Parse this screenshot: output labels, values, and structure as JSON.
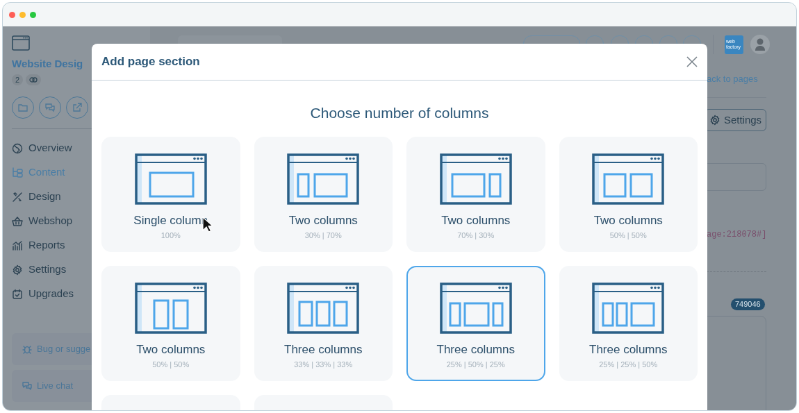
{
  "background_app": {
    "project_title": "Website Desig",
    "badge_count": "2",
    "nav": [
      {
        "label": "Overview",
        "selected": false
      },
      {
        "label": "Content",
        "selected": true
      },
      {
        "label": "Design",
        "selected": false
      },
      {
        "label": "Webshop",
        "selected": false
      },
      {
        "label": "Reports",
        "selected": false
      },
      {
        "label": "Settings",
        "selected": false
      },
      {
        "label": "Upgrades",
        "selected": false
      }
    ],
    "feedback_button": "Bug or sugge",
    "chat_button": "Live chat",
    "brand_logo": "web factory",
    "back_link": "ack to pages",
    "settings_button": "Settings",
    "shortcode": "age:218078#]",
    "id_badge": "749046"
  },
  "dialog": {
    "title": "Add page section",
    "heading": "Choose number of columns",
    "options": [
      {
        "kind": "single",
        "title": "Single column",
        "ratio": "100%",
        "selected": false
      },
      {
        "kind": "narrow-wide",
        "title": "Two columns",
        "ratio": "30% | 70%",
        "selected": false
      },
      {
        "kind": "wide-narrow",
        "title": "Two columns",
        "ratio": "70% | 30%",
        "selected": false
      },
      {
        "kind": "halves",
        "title": "Two columns",
        "ratio": "50% | 50%",
        "selected": false
      },
      {
        "kind": "tall-halves",
        "title": "Two columns",
        "ratio": "50% | 50%",
        "selected": false
      },
      {
        "kind": "thirds",
        "title": "Three columns",
        "ratio": "33% | 33% | 33%",
        "selected": false
      },
      {
        "kind": "center-wide",
        "title": "Three columns",
        "ratio": "25% | 50% | 25%",
        "selected": true
      },
      {
        "kind": "right-wide",
        "title": "Three columns",
        "ratio": "25% | 25% | 50%",
        "selected": false
      },
      {
        "kind": "cut-off",
        "selected": false
      },
      {
        "kind": "cut-off",
        "selected": false
      }
    ]
  }
}
